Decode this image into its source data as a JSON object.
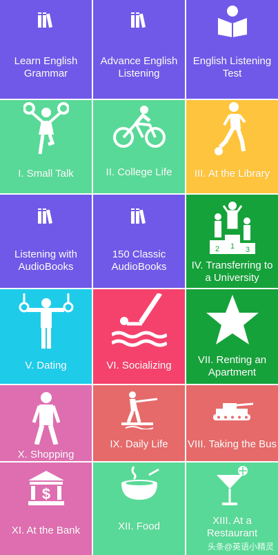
{
  "tiles": [
    {
      "label": "Learn English Grammar",
      "icon": "books-icon",
      "color": "#7059E8"
    },
    {
      "label": "Advance English Listening",
      "icon": "books-icon",
      "color": "#7059E8"
    },
    {
      "label": "English Listening Test",
      "icon": "reader-icon",
      "color": "#7059E8"
    },
    {
      "label": "I. Small Talk",
      "icon": "cheerleader-icon",
      "color": "#59D997"
    },
    {
      "label": "II. College Life",
      "icon": "cyclist-icon",
      "color": "#59D997"
    },
    {
      "label": "III. At the Library",
      "icon": "soccer-player-icon",
      "color": "#FFC43D"
    },
    {
      "label": "Listening with AudioBooks",
      "icon": "books-icon",
      "color": "#7059E8"
    },
    {
      "label": "150 Classic AudioBooks",
      "icon": "books-icon",
      "color": "#7059E8"
    },
    {
      "label": "IV. Transferring to a University",
      "icon": "podium-icon",
      "color": "#16A23A"
    },
    {
      "label": "V. Dating",
      "icon": "gymnast-rings-icon",
      "color": "#1ECCEA"
    },
    {
      "label": "VI. Socializing",
      "icon": "diver-icon",
      "color": "#F5426D"
    },
    {
      "label": "VII. Renting an Apartment",
      "icon": "star-icon",
      "color": "#16A23A"
    },
    {
      "label": "X. Shopping",
      "icon": "person-icon",
      "color": "#DE6EB0"
    },
    {
      "label": "IX. Daily Life",
      "icon": "water-skier-icon",
      "color": "#E66A6A"
    },
    {
      "label": "VIII. Taking the Bus",
      "icon": "tank-icon",
      "color": "#E66A6A"
    },
    {
      "label": "XI. At the Bank",
      "icon": "bank-icon",
      "color": "#DE6EB0"
    },
    {
      "label": "XII. Food",
      "icon": "soup-bowl-icon",
      "color": "#59D997"
    },
    {
      "label": "XIII. At a Restaurant",
      "icon": "cocktail-icon",
      "color": "#59D997"
    }
  ],
  "watermark": "头条@英语小精灵"
}
